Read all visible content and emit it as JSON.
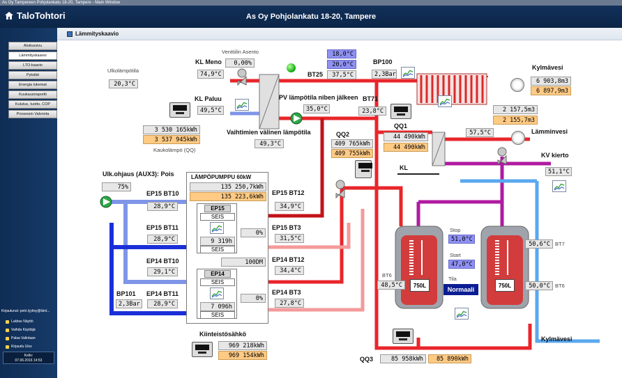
{
  "window": {
    "title": "As Oy Tampereen Pohjolankatu 18-20, Tampere - Main Window"
  },
  "app": {
    "logo": "TaloTohtori",
    "title": "As Oy Pohjolankatu 18-20, Tampere"
  },
  "page": {
    "title": "Lämmityskaavio"
  },
  "nav": [
    "Aloitussivu",
    "Lämmityskaavio",
    "LTO-kaavio",
    "Pykälät",
    "Energia lukemat",
    "Kuukausiraportti",
    "Kulutus, tuotto, COP",
    "Prosessin Valvonta"
  ],
  "sidebar": {
    "user_label": "Kirjautunut: petri.lyytisy@kiint...",
    "links": [
      "Lukitse Näyttö",
      "Vaihda Käyttäjä",
      "Palaa Valintaan",
      "Kirjaudu Ulos"
    ],
    "clock_label": "Kello:",
    "clock_value": "07.06.2016 14:53"
  },
  "labels": {
    "ulkolampotila": "Ulkolämpötila",
    "venttiilin_asento": "Venttiilin Asento",
    "kl_meno": "KL Meno",
    "kl_paluu": "KL Paluu",
    "bt25": "BT25",
    "bp100": "BP100",
    "kylmavesi_top": "Kylmävesi",
    "pv_lampotila": "PV lämpötila niben jälkeen",
    "bt71": "BT71",
    "qq1": "QQ1",
    "vaihtimien": "Vaihtimien välinen lämpötila",
    "kaukolampo": "Kaukolämpö (QQ)",
    "qq2": "QQ2",
    "lamminvesi": "Lämminvesi",
    "kv_kierto": "KV kierto",
    "kl": "KL",
    "ulk_ohjaus": "Ulk.ohjaus (AUX3): Pois",
    "lampopumppu": "LÄMPÖPUMPPU 60kW",
    "ep15_bt10": "EP15 BT10",
    "ep15_bt12": "EP15 BT12",
    "ep15_bt11": "EP15 BT11",
    "ep15_bt3": "EP15 BT3",
    "ep14_bt10": "EP14 BT10",
    "ep14_bt12": "EP14 BT12",
    "ep14_bt11": "EP14 BT11",
    "ep14_bt3": "EP14 BT3",
    "bp101": "BP101",
    "ep15": "EP15",
    "ep14": "EP14",
    "seis": "SEIS",
    "stop": "Stop",
    "start": "Start",
    "tila": "Tila",
    "normaali": "Normaali",
    "bt6_left": "BT6",
    "bt6_right": "BT6",
    "bt7": "BT7",
    "tank": "750L",
    "kylmavesi_bottom": "Kylmävesi",
    "kiinteistosahko": "Kiinteistösähkö",
    "qq3": "QQ3"
  },
  "values": {
    "ulkolampotila": "20,3°C",
    "venttiili": "0,00%",
    "kl_meno": "74,9°C",
    "kl_paluu": "49,5°C",
    "bt25_a": "18,0°C",
    "bt25_b": "20,0°C",
    "bt25_c": "37,5°C",
    "bp100": "2,3Bar",
    "kylmavesi_a": "6 903,8m3",
    "kylmavesi_b": "6 897,9m3",
    "pv": "35,0°C",
    "bt71": "23,8°C",
    "lv_a": "2 157,5m3",
    "lv_b": "2 155,7m3",
    "kaukolampo_a": "3 530 165kWh",
    "kaukolampo_b": "3 537 945kWh",
    "vaihtimien": "49,3°C",
    "qq2_a": "409 765kWh",
    "qq2_b": "409 755kWh",
    "qq1_a": "44 490kWh",
    "qq1_b": "44 490kWh",
    "lamminvesi": "57,5°C",
    "kv_kierto": "51,1°C",
    "ulk_pct": "75%",
    "hp_a": "135 250,7kWh",
    "hp_b": "135 223,6kWh",
    "ep15_bt10": "28,9°C",
    "ep15_bt12": "34,9°C",
    "ep15_bt11": "28,9°C",
    "ep15_pct": "0%",
    "ep15_kwh": "9 319h",
    "ep15_bt3": "31,5°C",
    "dm": "100DM",
    "ep14_bt10": "29,1°C",
    "ep14_bt12": "34,4°C",
    "ep14_pct": "0%",
    "ep14_kwh": "7 096h",
    "ep14_bt3": "27,8°C",
    "ep14_bt11": "28,9°C",
    "bp101": "2,3Bar",
    "stop": "51,0°C",
    "start": "47,0°C",
    "bt6_left": "48,5°C",
    "bt7": "50,6°C",
    "bt6_right": "50,0°C",
    "kiint_a": "969 218kWh",
    "kiint_b": "969 154kWh",
    "qq3_a": "85 958kWh",
    "qq3_b": "85 890kWh"
  },
  "colors": {
    "hot": "#e8262b",
    "hot_light": "#f39a9a",
    "cold": "#1b2fd8",
    "cold_light": "#7f95e8",
    "purple": "#b01aa0",
    "light_blue": "#5aa8ee",
    "navy": "#12305a"
  }
}
